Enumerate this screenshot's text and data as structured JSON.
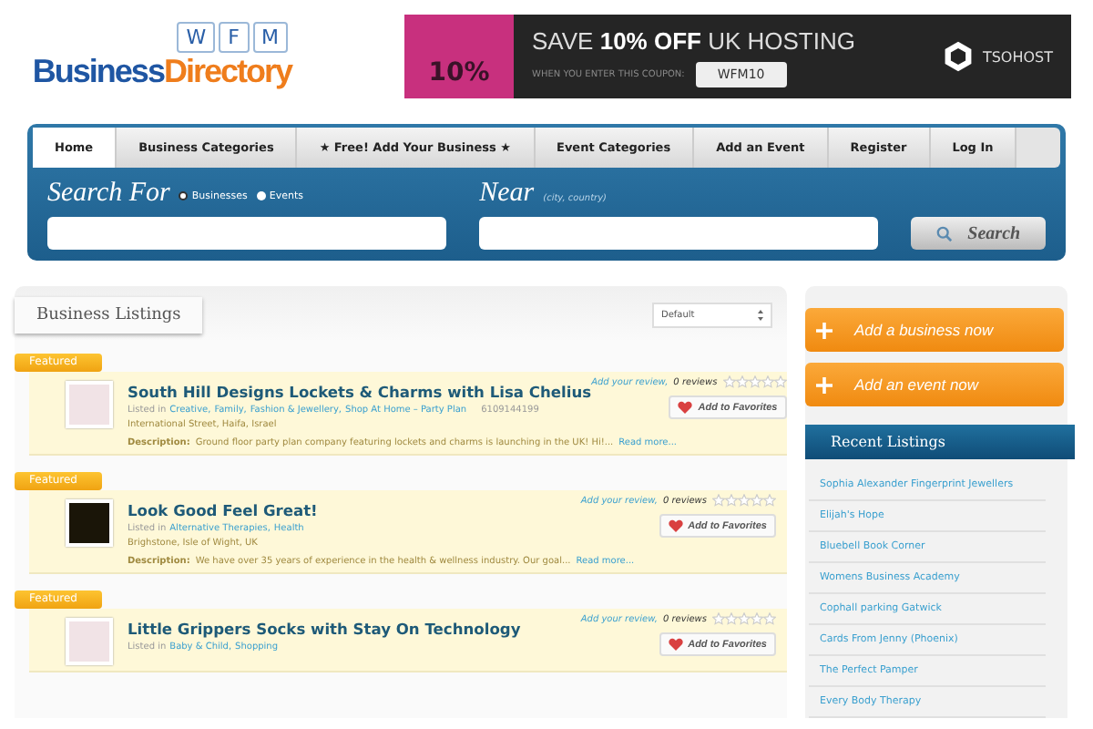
{
  "logo": {
    "letters": [
      "W",
      "F",
      "M"
    ],
    "word_1": "Business",
    "word_2": "Directory"
  },
  "banner": {
    "tag": "10%",
    "headline": "SAVE **10% OFF** UK HOSTING",
    "coupon_label": "WHEN YOU ENTER THIS COUPON:",
    "coupon": "WFM10",
    "brand": "TSOHOST"
  },
  "nav": [
    {
      "label": "Home",
      "selected": true
    },
    {
      "label": "Business Categories",
      "selected": false
    },
    {
      "label": "★ Free! Add Your Business ★",
      "selected": false
    },
    {
      "label": "Event Categories",
      "selected": false
    },
    {
      "label": "Add an Event",
      "selected": false
    },
    {
      "label": "Register",
      "selected": false
    },
    {
      "label": "Log In",
      "selected": false
    }
  ],
  "search": {
    "title": "Search For",
    "options": [
      {
        "label": "Businesses",
        "selected": true
      },
      {
        "label": "Events",
        "selected": false
      }
    ],
    "near_title": "Near",
    "near_hint": "(city, country)",
    "button": "Search"
  },
  "listings_panel": {
    "title": "Business Listings",
    "sort": "Default"
  },
  "listings": [
    {
      "badge": "Featured",
      "title": "South Hill Designs Lockets & Charms with Lisa Chelius",
      "listed_in": "Listed in",
      "categories": [
        "Creative,",
        "Family,",
        "Fashion & Jewellery,",
        "Shop At Home – Party Plan"
      ],
      "phone": "6109144199",
      "address": "International Street, Haifa, Israel",
      "description_label": "Description:",
      "description": "Ground floor party plan company featuring lockets and charms is launching in the UK! Hi!...",
      "read_more": "Read more...",
      "review_link": "Add your review,",
      "reviews": "0 reviews",
      "stars": 0,
      "favorite": "Add to Favorites"
    },
    {
      "badge": "Featured",
      "title": "Look Good Feel Great!",
      "listed_in": "Listed in",
      "categories": [
        "Alternative Therapies,",
        "Health"
      ],
      "address": "Brighstone, Isle of Wight, UK",
      "description_label": "Description:",
      "description": "We have over 35 years of experience in the health & wellness industry. Our goal...",
      "read_more": "Read more...",
      "review_link": "Add your review,",
      "reviews": "0 reviews",
      "stars": 0,
      "favorite": "Add to Favorites"
    },
    {
      "badge": "Featured",
      "title": "Little Grippers Socks with Stay On Technology",
      "listed_in": "Listed in",
      "categories": [
        "Baby & Child,",
        "Shopping"
      ],
      "review_link": "Add your review,",
      "reviews": "0 reviews",
      "stars": 0,
      "favorite": "Add to Favorites"
    }
  ],
  "sidebar": {
    "actions": [
      "Add a business now",
      "Add an event now"
    ],
    "recent_title": "Recent Listings",
    "recent": [
      "Sophia Alexander Fingerprint Jewellers",
      "Elijah's Hope",
      "Bluebell Book Corner",
      "Womens Business Academy",
      "Cophall parking Gatwick",
      "Cards From Jenny (Phoenix)",
      "The Perfect Pamper",
      "Every Body Therapy"
    ]
  }
}
